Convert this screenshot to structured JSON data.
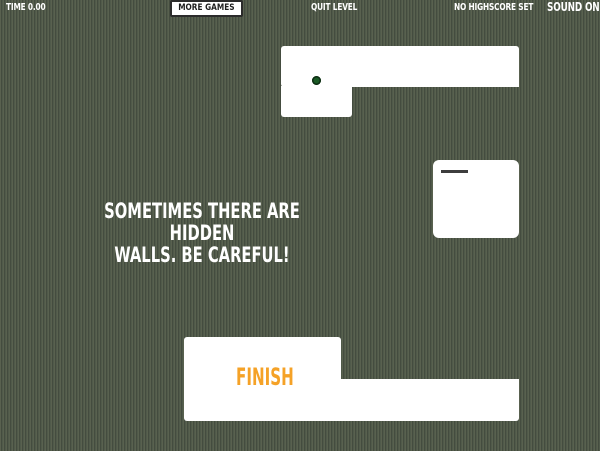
{
  "hud": {
    "time": "TIME 0.00",
    "more_games": "MORE GAMES",
    "quit": "QUIT LEVEL",
    "highscore": "NO HIGHSCORE SET",
    "sound": "SOUND ON"
  },
  "level": {
    "hint": "SOMETIMES THERE ARE HIDDEN\nWALLS. BE CAREFUL!",
    "finish_label": "FINISH"
  },
  "colors": {
    "background": "#4e5849",
    "path": "#ffffff",
    "finish_text": "#f5a227",
    "player": "#1a5a25"
  }
}
